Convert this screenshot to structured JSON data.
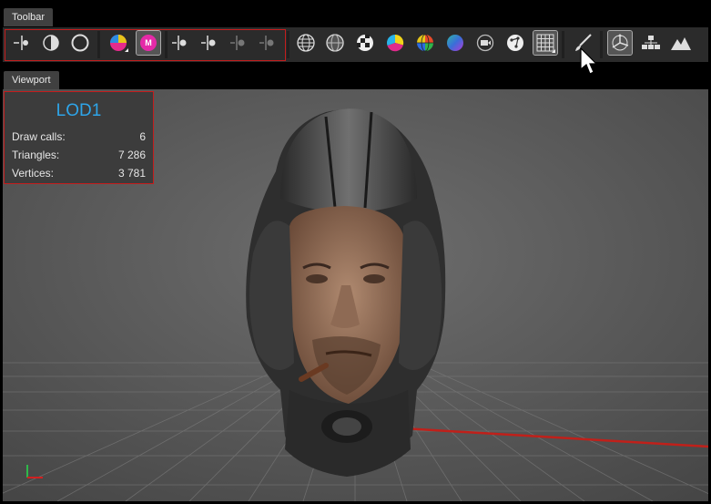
{
  "tabs": {
    "toolbar_label": "Toolbar",
    "viewport_label": "Viewport"
  },
  "toolbar": {
    "buttons": [
      {
        "name": "split-light-icon"
      },
      {
        "name": "contrast-icon"
      },
      {
        "name": "circle-outline-icon"
      },
      {
        "name": "color-wheel-icon"
      },
      {
        "name": "material-icon",
        "badge": "M"
      },
      {
        "name": "split-dot-left-icon"
      },
      {
        "name": "split-dot-right-icon"
      },
      {
        "name": "split-dot-dim-icon"
      },
      {
        "name": "split-dot-dim-2-icon"
      },
      {
        "name": "wireframe-sphere-icon"
      },
      {
        "name": "shaded-sphere-icon"
      },
      {
        "name": "checker-sphere-icon"
      },
      {
        "name": "color-channels-icon"
      },
      {
        "name": "color-grid-sphere-icon"
      },
      {
        "name": "gradient-sphere-icon"
      },
      {
        "name": "camera-icon"
      },
      {
        "name": "vertices-icon"
      },
      {
        "name": "grid-icon"
      },
      {
        "name": "brush-icon"
      },
      {
        "name": "transform-gizmo-icon"
      },
      {
        "name": "hierarchy-icon"
      },
      {
        "name": "terrain-icon"
      }
    ],
    "active_material_badge": "M"
  },
  "stats": {
    "lod": "LOD1",
    "draw_calls_label": "Draw calls:",
    "draw_calls": "6",
    "triangles_label": "Triangles:",
    "triangles": "7 286",
    "vertices_label": "Vertices:",
    "vertices": "3 781"
  },
  "colors": {
    "accent": "#2ea4e8",
    "highlight": "#c41d1d",
    "viewport_bg": "#5b5b5b"
  }
}
